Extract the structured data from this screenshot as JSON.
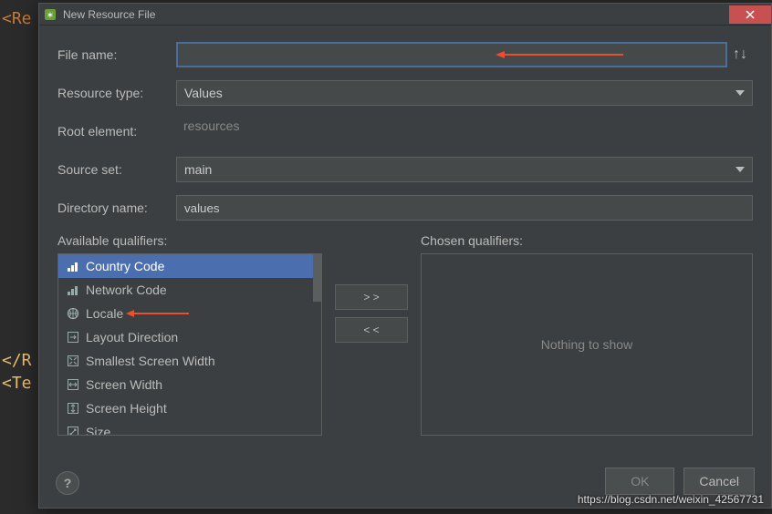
{
  "bg_code": [
    "<Re",
    "",
    "",
    "",
    "",
    "",
    "",
    "",
    "",
    "",
    "",
    "",
    "",
    "",
    "",
    "</R",
    "<Te"
  ],
  "title": "New Resource File",
  "labels": {
    "file_name": "File name:",
    "resource_type": "Resource type:",
    "root_element": "Root element:",
    "source_set": "Source set:",
    "directory_name": "Directory name:",
    "available": "Available qualifiers:",
    "chosen": "Chosen qualifiers:"
  },
  "values": {
    "file_name": "",
    "resource_type": "Values",
    "root_element": "resources",
    "source_set": "main",
    "directory_name": "values"
  },
  "qualifiers": {
    "available": [
      {
        "label": "Country Code",
        "icon": "signal",
        "selected": true
      },
      {
        "label": "Network Code",
        "icon": "signal"
      },
      {
        "label": "Locale",
        "icon": "globe"
      },
      {
        "label": "Layout Direction",
        "icon": "dir"
      },
      {
        "label": "Smallest Screen Width",
        "icon": "expand"
      },
      {
        "label": "Screen Width",
        "icon": "hwidth"
      },
      {
        "label": "Screen Height",
        "icon": "vheight"
      },
      {
        "label": "Size",
        "icon": "size"
      }
    ],
    "chosen_empty": "Nothing to show"
  },
  "buttons": {
    "move_right": "> >",
    "move_left": "< <",
    "ok": "OK",
    "cancel": "Cancel",
    "help": "?"
  },
  "sort_icon": "↑↓",
  "watermark": "https://blog.csdn.net/weixin_42567731"
}
